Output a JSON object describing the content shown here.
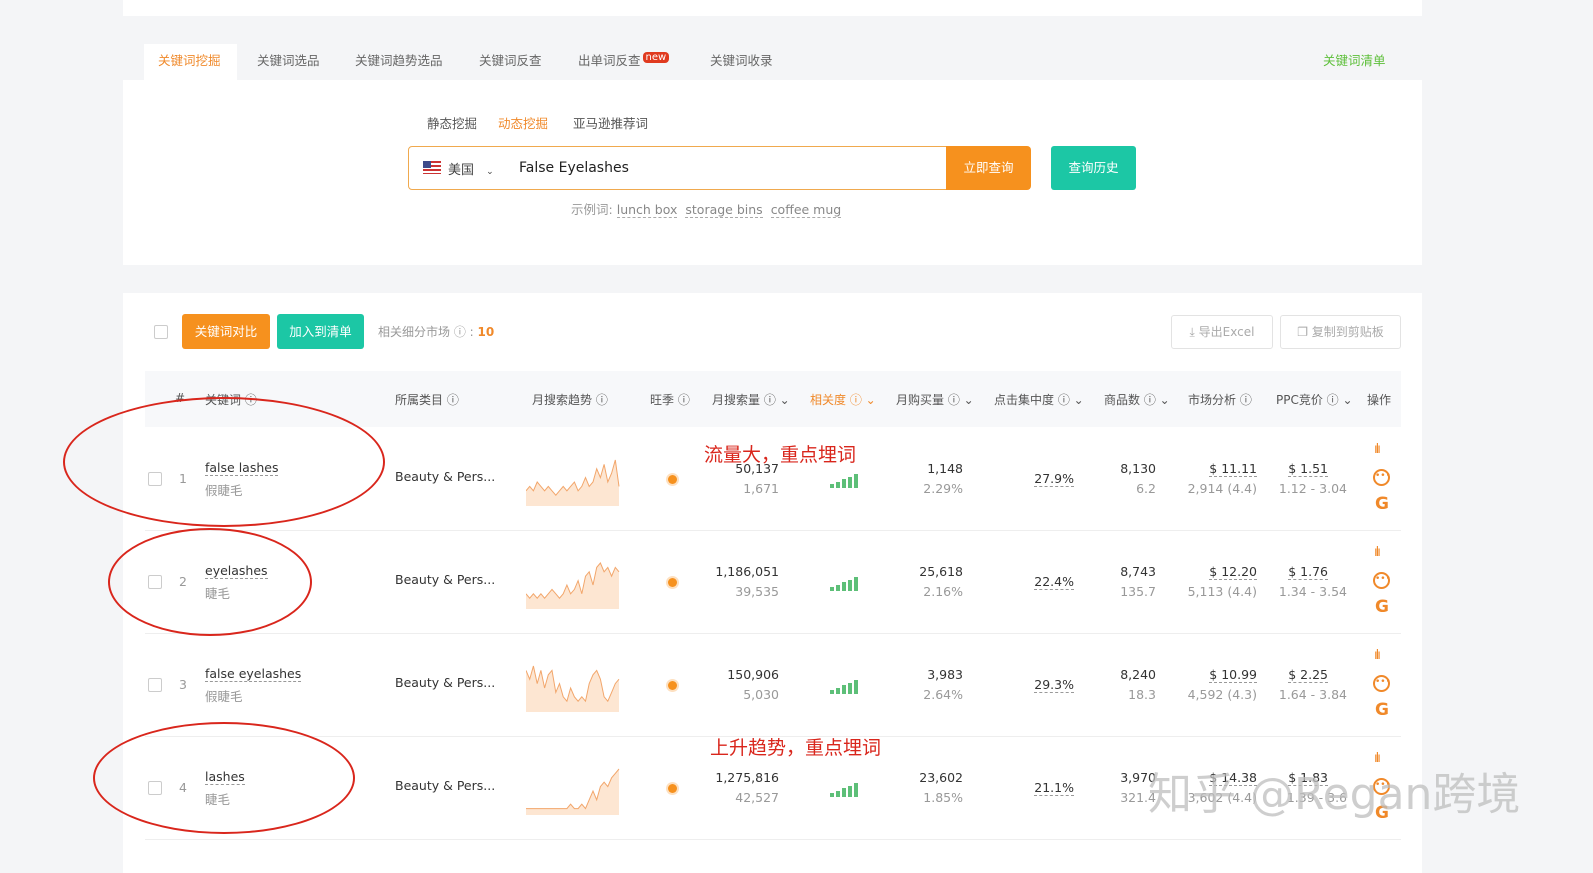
{
  "tabs": [
    {
      "label": "关键词挖掘",
      "active": true
    },
    {
      "label": "关键词选品"
    },
    {
      "label": "关键词趋势选品"
    },
    {
      "label": "关键词反查"
    },
    {
      "label": "出单词反查",
      "badge": "new"
    },
    {
      "label": "关键词收录"
    }
  ],
  "keyword_list_link": "关键词清单",
  "subtabs": [
    {
      "label": "静态挖掘"
    },
    {
      "label": "动态挖掘",
      "active": true
    },
    {
      "label": "亚马逊推荐词"
    }
  ],
  "search": {
    "country": "美国",
    "query": "False Eyelashes",
    "submit": "立即查询",
    "history": "查询历史"
  },
  "examples": {
    "label": "示例词:",
    "items": [
      "lunch box",
      "storage bins",
      "coffee mug"
    ]
  },
  "toolbar": {
    "compare": "关键词对比",
    "add_list": "加入到清单",
    "market_label": "相关细分市场",
    "market_count": "10",
    "export": "导出Excel",
    "copy": "复制到剪贴板"
  },
  "columns": [
    "#",
    "关键词",
    "所属类目",
    "月搜索趋势",
    "旺季",
    "月搜索量",
    "相关度",
    "月购买量",
    "点击集中度",
    "商品数",
    "市场分析",
    "PPC竞价",
    "操作"
  ],
  "colors": {
    "accent": "#f0892a",
    "teal": "#1cc7a5",
    "green": "#5dbf78",
    "annotation": "#d9261c"
  },
  "rows": [
    {
      "num": "1",
      "kw": "false lashes",
      "kw_cn": "假睫毛",
      "cat": "Beauty & Pers...",
      "search": "50,137",
      "search_sub": "1,671",
      "relevance": 5,
      "buy": "1,148",
      "buy_rate": "2.29%",
      "click": "27.9%",
      "products": "8,130",
      "products_sub": "6.2",
      "price": "$ 11.11",
      "reviews": "2,914 (4.4)",
      "ppc": "$ 1.51",
      "ppc_range": "1.12 - 3.04",
      "trend": [
        3,
        4,
        3,
        5,
        4,
        3,
        4,
        3,
        2,
        3,
        4,
        3,
        4,
        5,
        3,
        4,
        6,
        4,
        5,
        8,
        6,
        9,
        5,
        7,
        10,
        4
      ]
    },
    {
      "num": "2",
      "kw": "eyelashes",
      "kw_cn": "睫毛",
      "cat": "Beauty & Pers...",
      "search": "1,186,051",
      "search_sub": "39,535",
      "relevance": 5,
      "buy": "25,618",
      "buy_rate": "2.16%",
      "click": "22.4%",
      "products": "8,743",
      "products_sub": "135.7",
      "price": "$ 12.20",
      "reviews": "5,113 (4.4)",
      "ppc": "$ 1.76",
      "ppc_range": "1.34 - 3.54",
      "trend": [
        3,
        2,
        3,
        2,
        3,
        2,
        3,
        4,
        3,
        2,
        3,
        5,
        3,
        4,
        6,
        3,
        7,
        8,
        5,
        9,
        10,
        8,
        9,
        7,
        9,
        8
      ]
    },
    {
      "num": "3",
      "kw": "false eyelashes",
      "kw_cn": "假睫毛",
      "cat": "Beauty & Pers...",
      "search": "150,906",
      "search_sub": "5,030",
      "relevance": 5,
      "buy": "3,983",
      "buy_rate": "2.64%",
      "click": "29.3%",
      "products": "8,240",
      "products_sub": "18.3",
      "price": "$ 10.99",
      "reviews": "4,592 (4.3)",
      "ppc": "$ 2.25",
      "ppc_range": "1.64 - 3.84",
      "trend": [
        9,
        7,
        10,
        6,
        9,
        5,
        8,
        9,
        4,
        6,
        3,
        2,
        5,
        3,
        2,
        3,
        2,
        6,
        8,
        9,
        7,
        3,
        2,
        4,
        6,
        7
      ]
    },
    {
      "num": "4",
      "kw": "lashes",
      "kw_cn": "睫毛",
      "cat": "Beauty & Pers...",
      "search": "1,275,816",
      "search_sub": "42,527",
      "relevance": 5,
      "buy": "23,602",
      "buy_rate": "1.85%",
      "click": "21.1%",
      "products": "3,970",
      "products_sub": "321.4",
      "price": "$ 14.38",
      "reviews": "3,602 (4.4)",
      "ppc": "$ 1.83",
      "ppc_range": "1.39 - 3.6",
      "trend": [
        1,
        1,
        1,
        1,
        1,
        1,
        1,
        1,
        1,
        1,
        1,
        1,
        2,
        1,
        1,
        2,
        1,
        3,
        5,
        3,
        6,
        7,
        6,
        8,
        9,
        10
      ]
    }
  ],
  "annotations": [
    "流量大，重点埋词",
    "上升趋势，重点埋词"
  ],
  "watermark": "知乎 @Regan跨境"
}
